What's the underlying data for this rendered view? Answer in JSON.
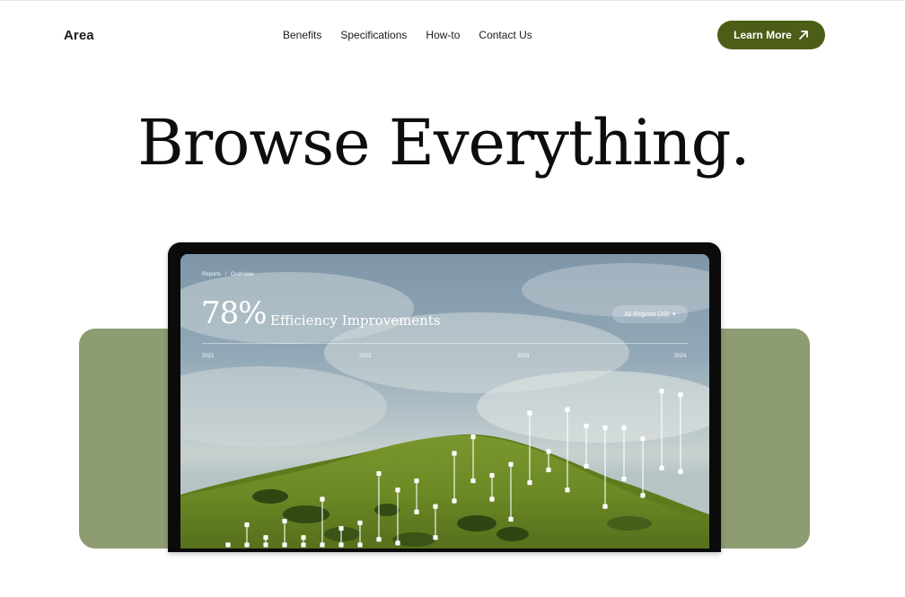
{
  "brand": "Area",
  "nav": {
    "items": [
      "Benefits",
      "Specifications",
      "How-to",
      "Contact Us"
    ],
    "cta_label": "Learn More"
  },
  "hero": {
    "title": "Browse Everything."
  },
  "dashboard": {
    "breadcrumb": [
      "Reports",
      "/",
      "Overview"
    ],
    "metric_value": "78%",
    "metric_label": "Efficiency Improvements",
    "region_filter": "All Regions (33)",
    "years": [
      "2021",
      "2022",
      "2023",
      "2024"
    ]
  },
  "colors": {
    "accent": "#4b5d16",
    "backdrop": "#8e9c72"
  },
  "chart_data": {
    "type": "range",
    "x_labels": [
      "2021",
      "2022",
      "2023",
      "2024"
    ],
    "ranges": [
      [
        0.02,
        0.02
      ],
      [
        0.02,
        0.13
      ],
      [
        0.02,
        0.06
      ],
      [
        0.02,
        0.15
      ],
      [
        0.02,
        0.06
      ],
      [
        0.02,
        0.27
      ],
      [
        0.02,
        0.11
      ],
      [
        0.02,
        0.14
      ],
      [
        0.05,
        0.41
      ],
      [
        0.03,
        0.32
      ],
      [
        0.2,
        0.37
      ],
      [
        0.06,
        0.23
      ],
      [
        0.26,
        0.52
      ],
      [
        0.37,
        0.61
      ],
      [
        0.27,
        0.4
      ],
      [
        0.16,
        0.46
      ],
      [
        0.36,
        0.74
      ],
      [
        0.43,
        0.53
      ],
      [
        0.32,
        0.76
      ],
      [
        0.45,
        0.67
      ],
      [
        0.23,
        0.66
      ],
      [
        0.38,
        0.66
      ],
      [
        0.29,
        0.6
      ],
      [
        0.44,
        0.86
      ],
      [
        0.42,
        0.84
      ]
    ]
  }
}
